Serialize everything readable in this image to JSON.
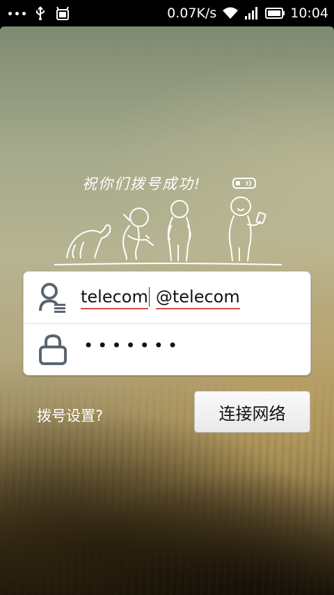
{
  "status_bar": {
    "network_speed": "0.07K/s",
    "time": "10:04",
    "icons": [
      "more-dots-icon",
      "usb-icon",
      "debug-icon",
      "wifi-icon",
      "signal-icon",
      "battery-icon"
    ]
  },
  "illustration": {
    "slogan": "祝你们拨号成功!"
  },
  "login": {
    "username_prefix": "telecom",
    "username_suffix": "@telecom",
    "password_mask": "•••••••"
  },
  "settings_link": "拨号设置?",
  "connect_button": "连接网络"
}
